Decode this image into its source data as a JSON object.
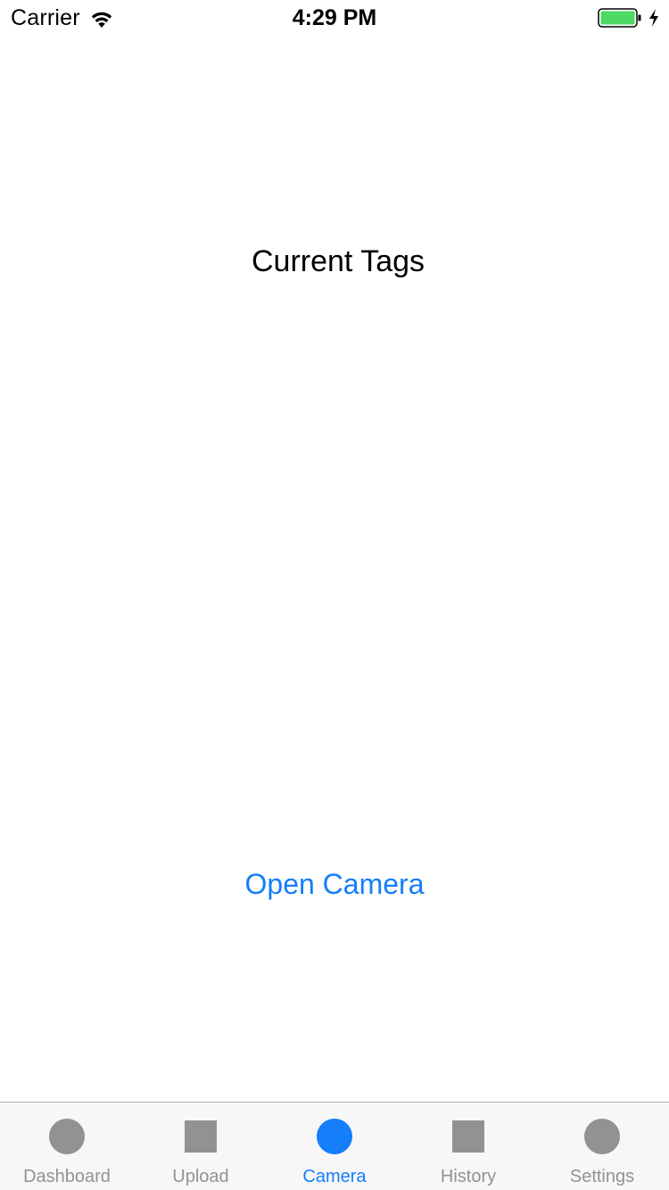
{
  "status_bar": {
    "carrier": "Carrier",
    "time": "4:29 PM",
    "icons": [
      "wifi-icon",
      "battery-icon",
      "charging-bolt-icon"
    ],
    "battery_color": "#4cd964"
  },
  "main": {
    "heading": "Current Tags",
    "open_camera_label": "Open Camera"
  },
  "tab_bar": {
    "active_color": "#147efb",
    "inactive_color": "#929292",
    "tabs": [
      {
        "label": "Dashboard",
        "icon": "circle-icon",
        "active": false
      },
      {
        "label": "Upload",
        "icon": "square-icon",
        "active": false
      },
      {
        "label": "Camera",
        "icon": "circle-icon",
        "active": true
      },
      {
        "label": "History",
        "icon": "square-icon",
        "active": false
      },
      {
        "label": "Settings",
        "icon": "circle-icon",
        "active": false
      }
    ]
  }
}
